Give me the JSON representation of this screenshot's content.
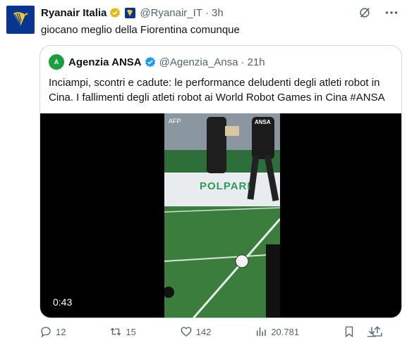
{
  "tweet": {
    "author_name": "Ryanair Italia",
    "handle": "@Ryanair_IT",
    "separator": "·",
    "time": "3h",
    "text": "giocano meglio della Fiorentina comunque"
  },
  "quote": {
    "avatar_label": "A",
    "author_name": "Agenzia ANSA",
    "handle": "@Agenzia_Ansa",
    "separator": "·",
    "time": "21h",
    "text": "Inciampi, scontri e cadute: le performance deludenti degli atleti robot in Cina. I fallimenti degli atleti robot ai World Robot Games in Cina #ANSA",
    "video": {
      "duration": "0:43",
      "sign_text": "POLPARI",
      "shirt_text": "ANSA",
      "corner_text": "AFP"
    }
  },
  "actions": {
    "reply_count": "12",
    "retweet_count": "15",
    "like_count": "142",
    "views_count": "20.781"
  },
  "colors": {
    "ryanair_blue": "#073590",
    "ryanair_yellow": "#f1c933",
    "verified_gold": "#e2b719",
    "verified_blue": "#1d9bf0",
    "muted_text": "#536471"
  }
}
